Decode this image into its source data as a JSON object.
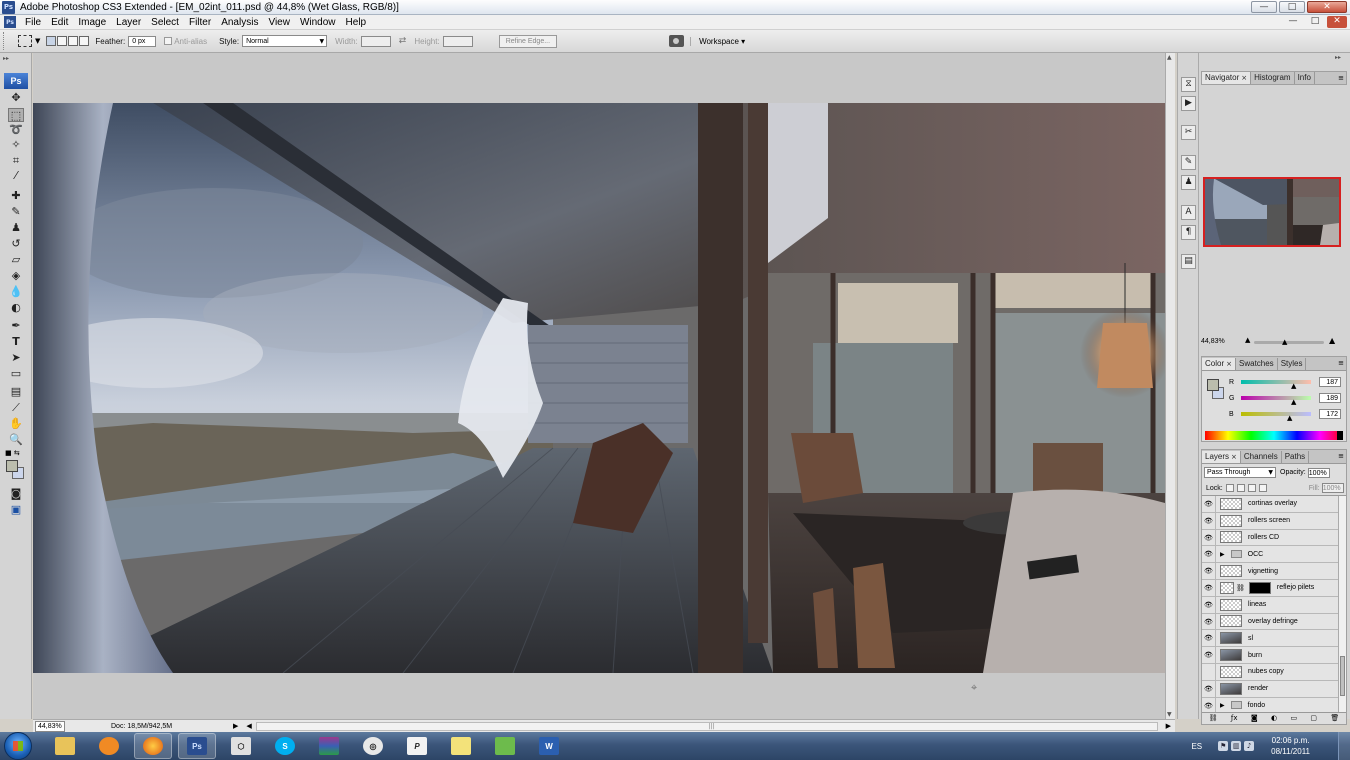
{
  "window": {
    "app_icon": "Ps",
    "title": "Adobe Photoshop CS3 Extended - [EM_02int_011.psd @ 44,8% (Wet Glass, RGB/8)]",
    "minimize": "—",
    "maximize": "□",
    "close": "✕"
  },
  "menu": {
    "items": [
      "File",
      "Edit",
      "Image",
      "Layer",
      "Select",
      "Filter",
      "Analysis",
      "View",
      "Window",
      "Help"
    ]
  },
  "options": {
    "feather_label": "Feather:",
    "feather_value": "0 px",
    "antialias_label": "Anti-alias",
    "style_label": "Style:",
    "style_value": "Normal",
    "width_label": "Width:",
    "height_label": "Height:",
    "refine_edge": "Refine Edge...",
    "workspace": "Workspace ▾"
  },
  "toolbox": {
    "logo": "Ps",
    "tools": [
      "move-tool",
      "marquee-tool",
      "lasso-tool",
      "magic-wand-tool",
      "crop-tool",
      "slice-tool",
      "healing-brush-tool",
      "brush-tool",
      "clone-stamp-tool",
      "history-brush-tool",
      "eraser-tool",
      "paint-bucket-tool",
      "blur-tool",
      "dodge-tool",
      "pen-tool",
      "type-tool",
      "path-selection-tool",
      "shape-tool",
      "notes-tool",
      "eyedropper-tool",
      "hand-tool",
      "zoom-tool"
    ],
    "foreground_color": "#bbbdad",
    "background_color": "#ccd6ec"
  },
  "status": {
    "zoom": "44,83%",
    "doc": "Doc: 18,5M/942,5M"
  },
  "navigator": {
    "tabs": [
      "Navigator",
      "Histogram",
      "Info"
    ],
    "zoom": "44,83%"
  },
  "color_panel": {
    "tabs": [
      "Color",
      "Swatches",
      "Styles"
    ],
    "r_label": "R",
    "g_label": "G",
    "b_label": "B",
    "r": "187",
    "g": "189",
    "b": "172"
  },
  "layers_panel": {
    "tabs": [
      "Layers",
      "Channels",
      "Paths"
    ],
    "blend_mode": "Pass Through",
    "opacity_label": "Opacity:",
    "opacity": "100%",
    "lock_label": "Lock:",
    "fill_label": "Fill:",
    "fill": "100%",
    "layers": [
      {
        "name": "cortinas overlay",
        "visible": true,
        "kind": "layer"
      },
      {
        "name": "rollers screen",
        "visible": true,
        "kind": "layer"
      },
      {
        "name": "rollers CD",
        "visible": true,
        "kind": "layer"
      },
      {
        "name": "OCC",
        "visible": true,
        "kind": "group"
      },
      {
        "name": "vignetting",
        "visible": true,
        "kind": "layer"
      },
      {
        "name": "reflejo pilets",
        "visible": true,
        "kind": "masked"
      },
      {
        "name": "lineas",
        "visible": true,
        "kind": "layer"
      },
      {
        "name": "overlay defringe",
        "visible": true,
        "kind": "layer"
      },
      {
        "name": "sl",
        "visible": true,
        "kind": "image"
      },
      {
        "name": "burn",
        "visible": true,
        "kind": "image"
      },
      {
        "name": "nubes copy",
        "visible": false,
        "kind": "layer"
      },
      {
        "name": "render",
        "visible": true,
        "kind": "image"
      },
      {
        "name": "fondo",
        "visible": true,
        "kind": "group"
      }
    ]
  },
  "taskbar": {
    "apps": [
      "explorer",
      "media-player",
      "firefox",
      "photoshop",
      "sketchup",
      "skype",
      "winrar",
      "3ds-max",
      "pixel",
      "sticky-notes",
      "network",
      "word"
    ],
    "photoshop_label": "Ps",
    "language": "ES",
    "time": "02:06 p.m.",
    "date": "08/11/2011"
  }
}
